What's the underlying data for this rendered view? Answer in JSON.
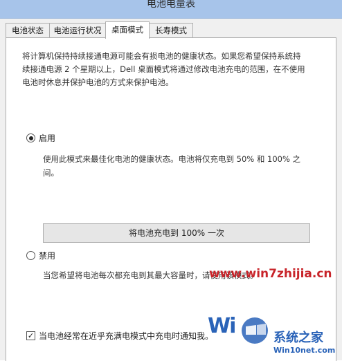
{
  "window": {
    "title": "电池电量表"
  },
  "tabs": [
    {
      "label": "电池状态",
      "active": false
    },
    {
      "label": "电池运行状况",
      "active": false
    },
    {
      "label": "桌面模式",
      "active": true
    },
    {
      "label": "长寿模式",
      "active": false
    }
  ],
  "panel": {
    "intro_line1": "将计算机保持持续接通电源可能会有损电池的健康状态。如果您希望保持系统持",
    "intro_line2": "续接通电源 2 个星期以上，Dell 桌面模式将通过修改电池充电的范围，在不使用",
    "intro_line3": "电池时休息并保护电池的方式来保护电池。",
    "enable": {
      "label": "启用",
      "selected": true,
      "desc_line1": "使用此模式来最佳化电池的健康状态。电池将仅充电到 50% 和 100% 之",
      "desc_line2": "间。"
    },
    "charge_button_label": "将电池充电到 100% 一次",
    "disable": {
      "label": "禁用",
      "selected": false,
      "desc": "当您希望将电池每次都充电到其最大容量时，请使用该模式。"
    },
    "notify_checkbox": {
      "label": "当电池经常在近乎充满电模式中充电时通知我。",
      "checked": true
    }
  },
  "watermark": {
    "url1": "www.win7zhijia.cn",
    "site_name": "系统之家",
    "url2": "Win10net.com",
    "logo_text": "Wi"
  },
  "colors": {
    "titlebar": "#a7c4ea",
    "panel_bg": "#ffffff",
    "chrome_bg": "#f0f0f0",
    "button_bg": "#e6e6e6",
    "border": "#adadad",
    "watermark_red": "#c8242a",
    "watermark_blue": "#2a63b8"
  }
}
